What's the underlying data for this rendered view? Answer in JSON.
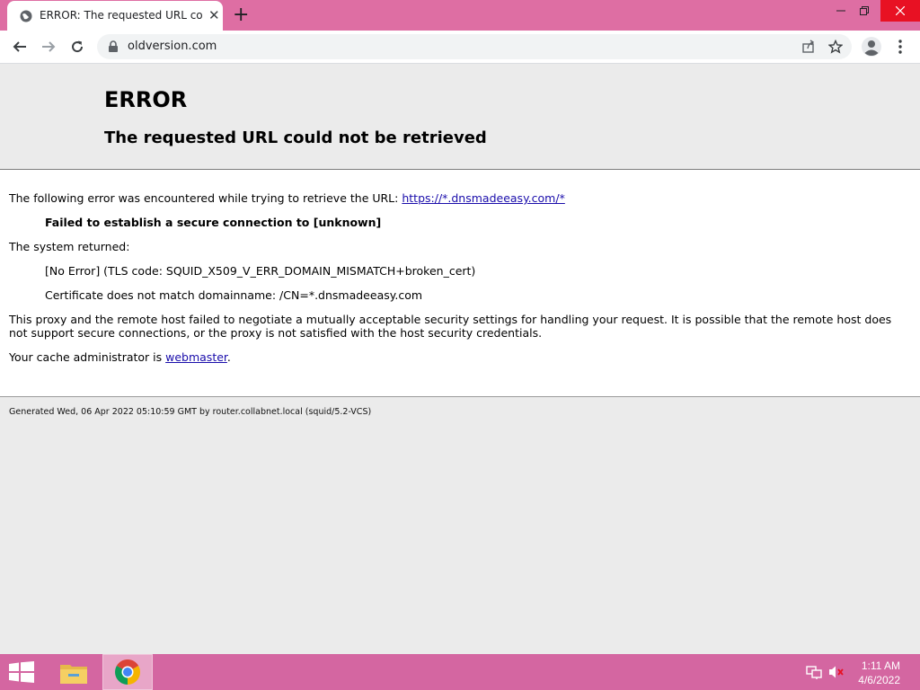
{
  "browser": {
    "tab_title": "ERROR: The requested URL could not be retrieved",
    "url": "oldversion.com",
    "new_tab_symbol": "+",
    "tab_close_symbol": "✕"
  },
  "page": {
    "heading": "ERROR",
    "subheading": "The requested URL could not be retrieved",
    "intro_text": "The following error was encountered while trying to retrieve the URL: ",
    "intro_link": "https://*.dnsmadeeasy.com/*",
    "failed_text": "Failed to establish a secure connection to [unknown]",
    "system_returned": "The system returned:",
    "error_code": "[No Error] (TLS code: SQUID_X509_V_ERR_DOMAIN_MISMATCH+broken_cert)",
    "cert_mismatch": "Certificate does not match domainname: /CN=*.dnsmadeeasy.com",
    "explanation": "This proxy and the remote host failed to negotiate a mutually acceptable security settings for handling your request. It is possible that the remote host does not support secure connections, or the proxy is not satisfied with the host security credentials.",
    "admin_prefix": "Your cache administrator is ",
    "admin_link": "webmaster",
    "admin_suffix": ".",
    "footer": "Generated Wed, 06 Apr 2022 05:10:59 GMT by router.collabnet.local (squid/5.2-VCS)"
  },
  "taskbar": {
    "time": "1:11 AM",
    "date": "4/6/2022"
  },
  "colors": {
    "titlebar": "#de6ea3",
    "taskbar": "#d466a1",
    "link": "#1a0dab"
  },
  "icons": [
    "globe-icon",
    "close-icon",
    "new-tab-icon",
    "minimize-icon",
    "restore-icon",
    "window-close-icon",
    "back-icon",
    "forward-icon",
    "reload-icon",
    "lock-icon",
    "share-icon",
    "star-icon",
    "profile-icon",
    "menu-icon",
    "windows-start-icon",
    "file-explorer-icon",
    "chrome-icon",
    "network-icon",
    "volume-muted-icon"
  ]
}
